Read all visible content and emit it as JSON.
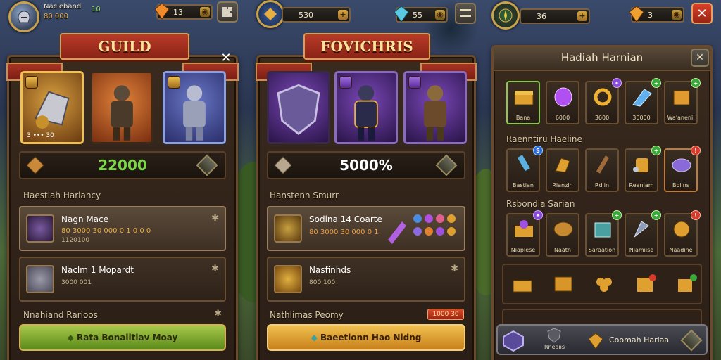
{
  "theme": {
    "accent_gold": "#c99a3a",
    "panel_brown": "#3a2a1e",
    "banner_red": "#b83a28",
    "value_green": "#7ad84a"
  },
  "left": {
    "topbar": {
      "name": "Nacleband",
      "subname": "80 000",
      "level": "10",
      "gem_value": "13",
      "avatar_icon": "helmet-icon",
      "menu_icon": "puzzle-icon"
    },
    "panel": {
      "title": "GUILD",
      "close_label": "✕",
      "cards": [
        {
          "name": "hero-card-armor",
          "tint": "gold",
          "stats": "3 ••• 30"
        },
        {
          "name": "hero-card-warrior",
          "tint": "orange"
        },
        {
          "name": "hero-card-knight",
          "tint": "blue"
        }
      ],
      "value": "22000",
      "section1": "Haestiah Harlancy",
      "rows": [
        {
          "title": "Nagn Mace",
          "sub": "80 3000 30 000 0 1 0 0 0",
          "sub2": "1120100"
        },
        {
          "title": "Naclm 1 Mopardt",
          "sub2": "3000 001"
        }
      ],
      "section2": "Nnahiand Rarioos",
      "button": "Rata Bonalitlav Moay"
    }
  },
  "middle": {
    "topbar": {
      "gold_value": "530",
      "gem_value": "55",
      "add_label": "+",
      "menu_icon": "menu-icon"
    },
    "panel": {
      "title": "FOVICHRIS",
      "value": "5000%",
      "section1": "Hanstenn Smurr",
      "rows": [
        {
          "title": "Sodina 14 Coarte",
          "sub": "80 3000 30 000 0 1"
        },
        {
          "title": "Nasfinhds",
          "sub2": "800 100"
        }
      ],
      "section2": "Nathlimas Peomy",
      "badge": "1000 30",
      "button": "Baeetionn Hao Nidng"
    }
  },
  "right": {
    "topbar": {
      "gold_value": "36",
      "gem_value": "3",
      "add_label": "+",
      "close_label": "✕"
    },
    "panel": {
      "title": "Hadiah Harnian",
      "close_label": "✕",
      "row1": [
        {
          "label": "Bana",
          "art": "gold-chest-icon"
        },
        {
          "label": "6000",
          "art": "purple-gem-icon"
        },
        {
          "label": "3600",
          "art": "gold-ring-icon"
        },
        {
          "label": "30000",
          "art": "blue-crystal-icon"
        },
        {
          "label": "Wa'anenii",
          "art": "gold-box-icon"
        }
      ],
      "section2": "Raenntiru Haeline",
      "row2": [
        {
          "label": "Bastlan",
          "art": "blue-sword-icon"
        },
        {
          "label": "Rianzin",
          "art": "gold-gauntlet-icon"
        },
        {
          "label": "Rdiin",
          "art": "wood-staff-icon"
        },
        {
          "label": "Reaniam",
          "art": "gold-potion-icon"
        },
        {
          "label": "Boiins",
          "art": "purple-orb-icon"
        }
      ],
      "section3": "Rsbondia Sarian",
      "row3": [
        {
          "label": "Niaplese",
          "art": "purple-chest-icon"
        },
        {
          "label": "Naatn",
          "art": "gold-barrel-icon"
        },
        {
          "label": "Saraation",
          "art": "teal-box-icon"
        },
        {
          "label": "Niamiise",
          "art": "steel-drill-icon"
        },
        {
          "label": "Naadine",
          "art": "gold-cauldron-icon"
        }
      ],
      "row4": [
        {
          "art": "gold-chest-icon"
        },
        {
          "art": "gold-crate-icon"
        },
        {
          "art": "gold-clover-icon"
        },
        {
          "art": "gold-box-icon"
        },
        {
          "art": "gold-cube-icon"
        }
      ],
      "footer": {
        "item1": "Rneaiis",
        "item2": "Coomah Harlaa"
      }
    }
  }
}
